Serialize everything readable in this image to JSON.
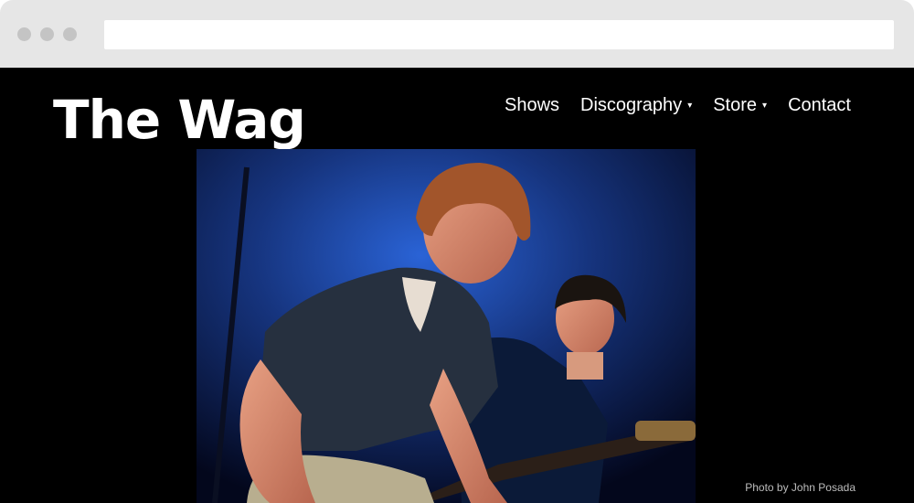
{
  "site": {
    "title": "The Wag"
  },
  "nav": {
    "items": [
      {
        "label": "Shows",
        "dropdown": false
      },
      {
        "label": "Discography",
        "dropdown": true
      },
      {
        "label": "Store",
        "dropdown": true
      },
      {
        "label": "Contact",
        "dropdown": false
      }
    ],
    "caret_glyph": "▾"
  },
  "hero": {
    "credit": "Photo by John Posada"
  },
  "colors": {
    "page_background": "#000000",
    "chrome": "#e6e6e6",
    "text": "#ffffff",
    "stage_light": "#1f4fb8"
  }
}
